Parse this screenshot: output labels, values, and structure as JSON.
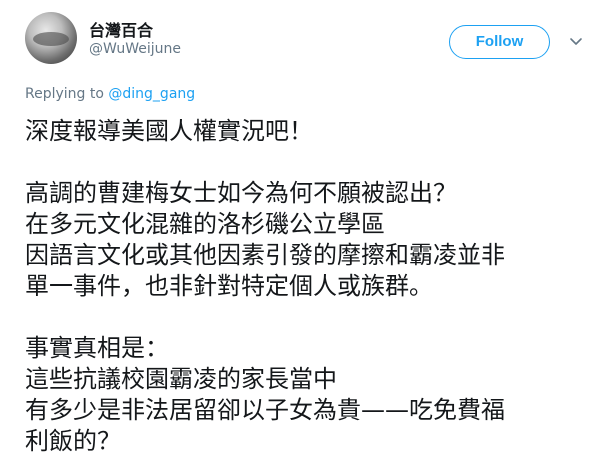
{
  "tweet": {
    "display_name": "台灣百合",
    "handle": "@WuWeijune",
    "follow_label": "Follow",
    "reply_prefix": "Replying to ",
    "reply_to": "@ding_gang",
    "lines": [
      "深度報導美國人權實況吧！",
      "",
      "高調的曹建梅女士如今為何不願被認出？",
      "在多元文化混雜的洛杉磯公立學區",
      "因語言文化或其他因素引發的摩擦和霸凌並非",
      "單一事件，也非針對特定個人或族群。",
      "",
      "事實真相是：",
      "這些抗議校園霸凌的家長當中",
      "有多少是非法居留卻以子女為貴——吃免費福",
      "利飯的？"
    ]
  },
  "colors": {
    "accent": "#1da1f2",
    "text": "#14171a",
    "muted": "#657786"
  }
}
